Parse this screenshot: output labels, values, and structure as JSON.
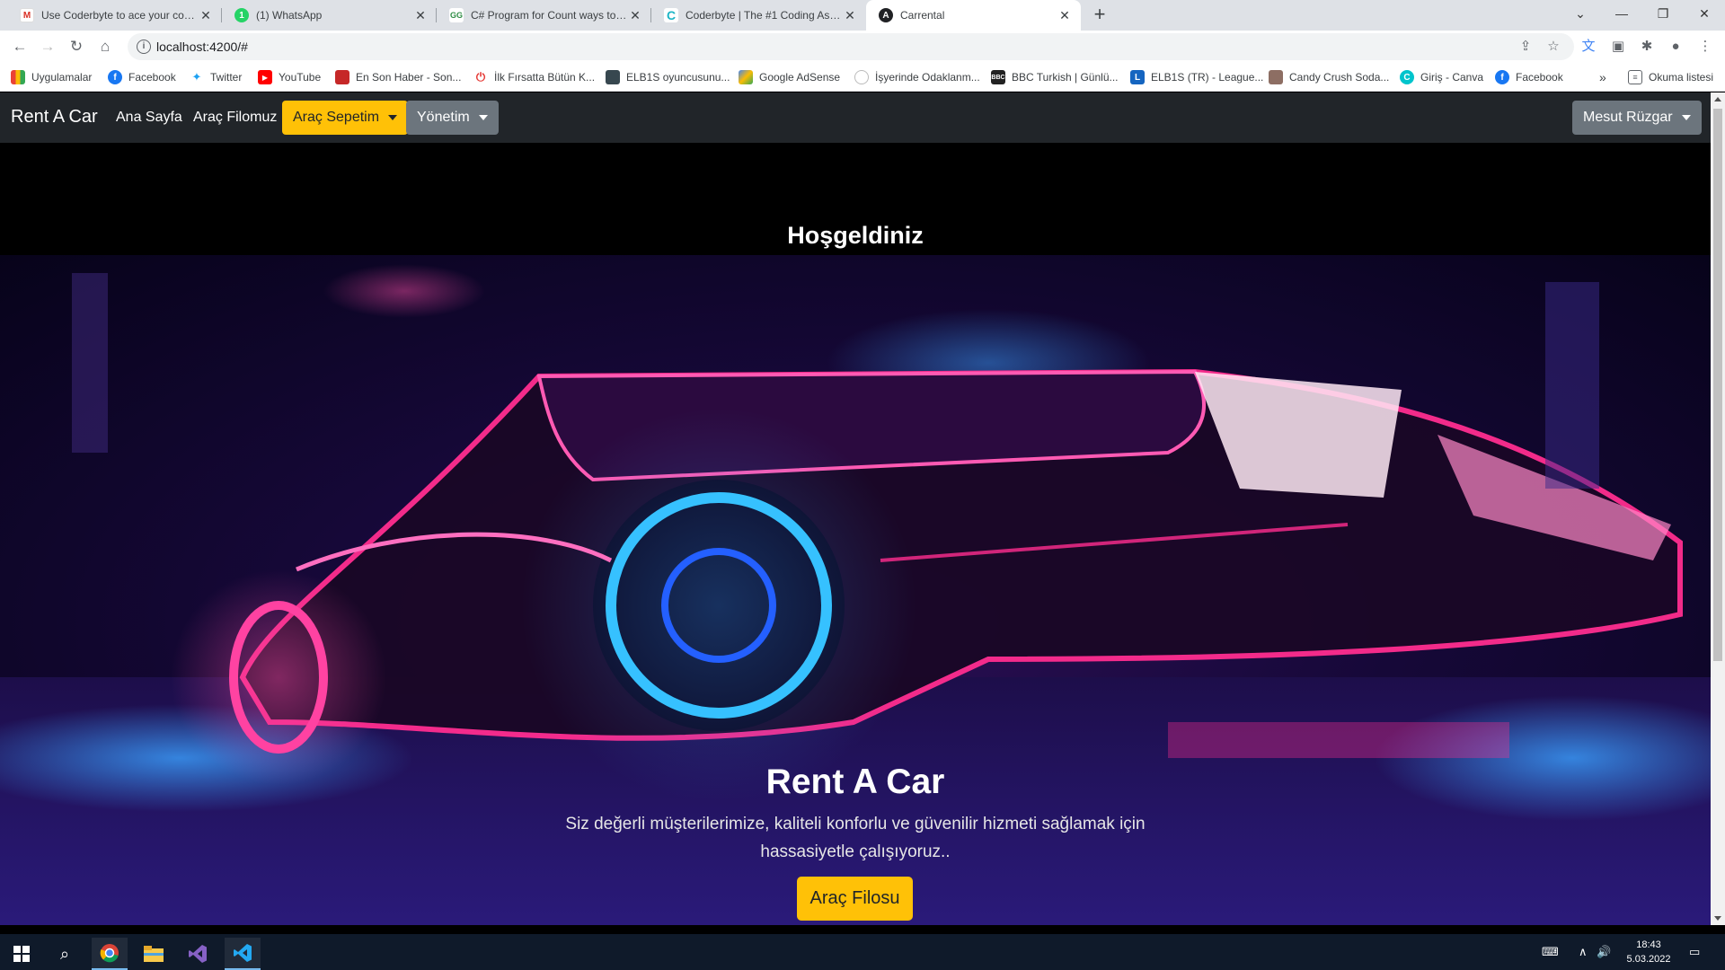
{
  "browser": {
    "tabs": [
      {
        "title": "Use Coderbyte to ace your coding",
        "icon": "gmail-icon",
        "color": "#d93025"
      },
      {
        "title": "(1) WhatsApp",
        "icon": "whatsapp-icon",
        "color": "#25d366"
      },
      {
        "title": "C# Program for Count ways to re",
        "icon": "geeksforgeeks-icon",
        "color": "#2f8d46"
      },
      {
        "title": "Coderbyte | The #1 Coding Asses",
        "icon": "coderbyte-icon",
        "color": "#1cb5c6"
      },
      {
        "title": "Carrental",
        "icon": "angular-icon",
        "color": "#202124"
      }
    ],
    "url": "localhost:4200/#",
    "bookmarks": [
      {
        "label": "Uygulamalar",
        "icon": "apps-grid-icon",
        "color": "#ea4335"
      },
      {
        "label": "Facebook",
        "icon": "facebook-icon",
        "color": "#1877f2"
      },
      {
        "label": "Twitter",
        "icon": "twitter-icon",
        "color": "#1da1f2"
      },
      {
        "label": "YouTube",
        "icon": "youtube-icon",
        "color": "#ff0000"
      },
      {
        "label": "En Son Haber - Son...",
        "icon": "news-icon",
        "color": "#c62828"
      },
      {
        "label": "İlk Fırsatta Bütün K...",
        "icon": "power-icon",
        "color": "#e53935"
      },
      {
        "label": "ELB1S oyuncusunu...",
        "icon": "game-icon",
        "color": "#37474f"
      },
      {
        "label": "Google AdSense",
        "icon": "adsense-icon",
        "color": "#fbbc04"
      },
      {
        "label": "İşyerinde Odaklanm...",
        "icon": "site-icon",
        "color": "#9e9e9e"
      },
      {
        "label": "BBC Turkish | Günlü...",
        "icon": "bbc-icon",
        "color": "#222222"
      },
      {
        "label": "ELB1S (TR) - League...",
        "icon": "league-icon",
        "color": "#1565c0"
      },
      {
        "label": "Candy Crush Soda...",
        "icon": "candy-icon",
        "color": "#8d6e63"
      },
      {
        "label": "Giriş - Canva",
        "icon": "canva-icon",
        "color": "#00c4cc"
      },
      {
        "label": "Facebook",
        "icon": "facebook-icon",
        "color": "#1877f2"
      }
    ],
    "reading_list": "Okuma listesi",
    "more_bookmarks": "»"
  },
  "navbar": {
    "brand": "Rent A Car",
    "links": [
      "Ana Sayfa",
      "Araç Filomuz"
    ],
    "cart_button": "Araç Sepetim",
    "admin_button": "Yönetim",
    "user_button": "Mesut Rüzgar"
  },
  "page": {
    "welcome": "Hoşgeldiniz",
    "hero_title": "Rent A Car",
    "hero_text": "Siz değerli müşterilerimize, kaliteli konforlu ve güvenilir hizmeti sağlamak için hassasiyetle çalışıyoruz..",
    "hero_button": "Araç Filosu"
  },
  "taskbar": {
    "time": "18:43",
    "date": "5.03.2022"
  },
  "colors": {
    "accent": "#ffc107",
    "navbar": "#212529",
    "secondary": "#6c757d"
  }
}
